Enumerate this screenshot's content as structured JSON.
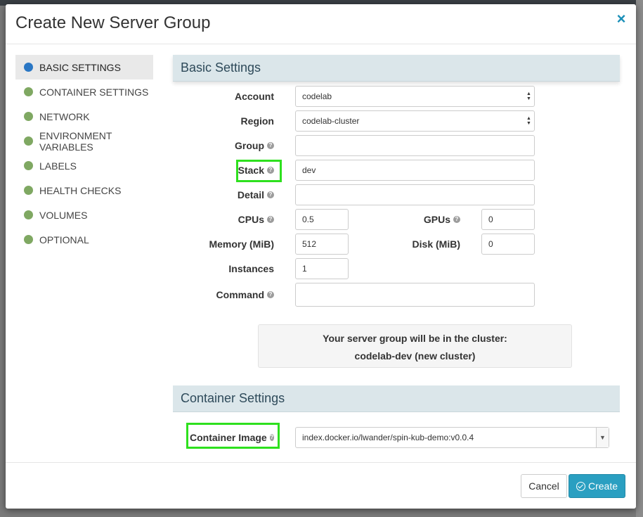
{
  "dialog": {
    "title": "Create New Server Group",
    "close_glyph": "×"
  },
  "sidebar": {
    "items": [
      {
        "label": "BASIC SETTINGS",
        "active": true
      },
      {
        "label": "CONTAINER SETTINGS",
        "active": false
      },
      {
        "label": "NETWORK",
        "active": false
      },
      {
        "label": "ENVIRONMENT VARIABLES",
        "active": false
      },
      {
        "label": "LABELS",
        "active": false
      },
      {
        "label": "HEALTH CHECKS",
        "active": false
      },
      {
        "label": "VOLUMES",
        "active": false
      },
      {
        "label": "OPTIONAL",
        "active": false
      }
    ],
    "active_dot_color": "#2a77c4",
    "dot_color": "#7fa862"
  },
  "basic_settings": {
    "header": "Basic Settings",
    "account": {
      "label": "Account",
      "value": "codelab"
    },
    "region": {
      "label": "Region",
      "value": "codelab-cluster"
    },
    "group": {
      "label": "Group",
      "value": ""
    },
    "stack": {
      "label": "Stack",
      "value": "dev"
    },
    "detail": {
      "label": "Detail",
      "value": ""
    },
    "cpus": {
      "label": "CPUs",
      "value": "0.5"
    },
    "gpus": {
      "label": "GPUs",
      "value": "0"
    },
    "memory": {
      "label": "Memory (MiB)",
      "value": "512"
    },
    "disk": {
      "label": "Disk (MiB)",
      "value": "0"
    },
    "instances": {
      "label": "Instances",
      "value": "1"
    },
    "command": {
      "label": "Command",
      "value": ""
    },
    "cluster_info": {
      "line1": "Your server group will be in the cluster:",
      "line2": "codelab-dev (new cluster)"
    }
  },
  "container_settings": {
    "header": "Container Settings",
    "image": {
      "label": "Container Image",
      "value": "index.docker.io/lwander/spin-kub-demo:v0.0.4"
    }
  },
  "footer": {
    "cancel_label": "Cancel",
    "create_label": "Create"
  },
  "colors": {
    "accent": "#2a9fc1",
    "highlight": "#2ee01e",
    "section_bg": "#dbe6ea"
  }
}
